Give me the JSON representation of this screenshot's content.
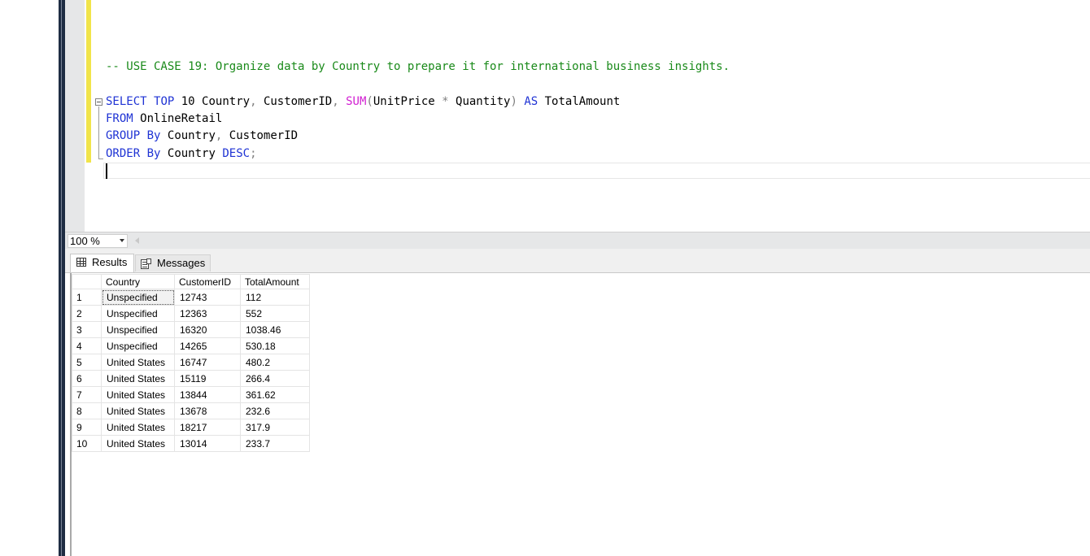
{
  "editor": {
    "comment": "-- USE CASE 19: Organize data by Country to prepare it for international business insights.",
    "line2": {
      "kw1": "SELECT",
      "kw2": "TOP",
      "num": "10",
      "p1": "Country",
      "c1": ",",
      "p2": "CustomerID",
      "c2": ",",
      "fn": "SUM",
      "lp": "(",
      "p3": "UnitPrice",
      "star": "*",
      "p4": "Quantity",
      "rp": ")",
      "kw3": "AS",
      "p5": "TotalAmount"
    },
    "line3": {
      "kw": "FROM",
      "p": "OnlineRetail"
    },
    "line4": {
      "kw1": "GROUP",
      "kw2": "By",
      "p1": "Country",
      "c": ",",
      "p2": "CustomerID"
    },
    "line5": {
      "kw1": "ORDER",
      "kw2": "By",
      "p1": "Country",
      "kw3": "DESC",
      "semi": ";"
    }
  },
  "zoom": {
    "value": "100 %"
  },
  "tabs": {
    "results": "Results",
    "messages": "Messages"
  },
  "grid": {
    "columns": [
      "Country",
      "CustomerID",
      "TotalAmount"
    ],
    "rows": [
      [
        "1",
        "Unspecified",
        "12743",
        "112"
      ],
      [
        "2",
        "Unspecified",
        "12363",
        "552"
      ],
      [
        "3",
        "Unspecified",
        "16320",
        "1038.46"
      ],
      [
        "4",
        "Unspecified",
        "14265",
        "530.18"
      ],
      [
        "5",
        "United States",
        "16747",
        "480.2"
      ],
      [
        "6",
        "United States",
        "15119",
        "266.4"
      ],
      [
        "7",
        "United States",
        "13844",
        "361.62"
      ],
      [
        "8",
        "United States",
        "13678",
        "232.6"
      ],
      [
        "9",
        "United States",
        "18217",
        "317.9"
      ],
      [
        "10",
        "United States",
        "13014",
        "233.7"
      ]
    ]
  },
  "colors": {
    "keyword": "#1f33d4",
    "comment": "#1a8a1a",
    "function": "#d11fd1",
    "change_bar": "#f1e44a"
  }
}
